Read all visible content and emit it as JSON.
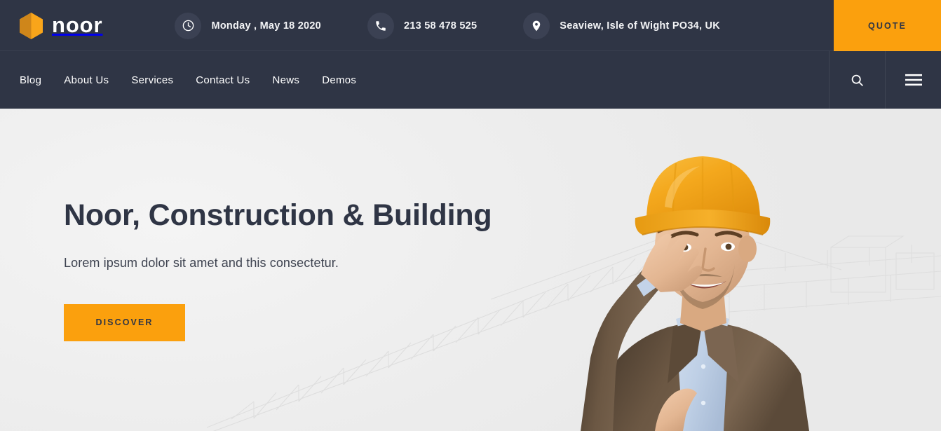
{
  "brand": {
    "name": "noor",
    "logo_icon": "cube-logo-icon",
    "logo_color_light": "#f9a51a",
    "logo_color_dark": "#cf861a"
  },
  "topbar": {
    "background": "#2f3545",
    "items": [
      {
        "icon": "clock-icon",
        "text": "Monday , May 18 2020"
      },
      {
        "icon": "phone-icon",
        "text": "213 58 478 525"
      },
      {
        "icon": "map-pin-icon",
        "text": "Seaview, Isle of Wight PO34, UK"
      }
    ],
    "quote_label": "QUOTE",
    "accent_color": "#fba00d"
  },
  "nav": {
    "items": [
      {
        "label": "Blog"
      },
      {
        "label": "About Us"
      },
      {
        "label": "Services"
      },
      {
        "label": "Contact Us"
      },
      {
        "label": "News"
      },
      {
        "label": "Demos"
      }
    ],
    "tools": [
      {
        "icon": "search-icon"
      },
      {
        "icon": "hamburger-menu-icon"
      }
    ]
  },
  "hero": {
    "title": "Noor, Construction & Building",
    "subtitle": "Lorem ipsum dolor sit amet and this consectetur.",
    "cta_label": "DISCOVER",
    "background_color": "#efefef",
    "title_color": "#2f3545",
    "image_description": "Smiling man in yellow hard hat and brown suit with light blue shirt, faint tower-crane line drawing behind"
  }
}
